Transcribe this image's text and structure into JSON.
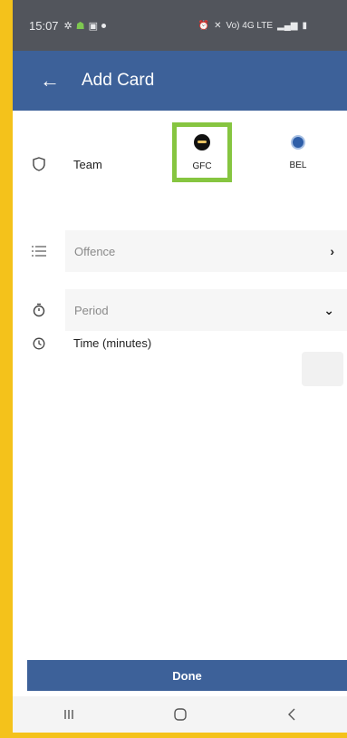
{
  "status_bar": {
    "time": "15:07",
    "right_text": "Vo) 4G LTE"
  },
  "app_bar": {
    "title": "Add Card"
  },
  "team_row": {
    "label": "Team",
    "options": [
      {
        "code": "GFC",
        "selected": true
      },
      {
        "code": "BEL",
        "selected": false
      }
    ]
  },
  "offence_field": {
    "placeholder": "Offence"
  },
  "period_field": {
    "placeholder": "Period"
  },
  "time_row": {
    "label": "Time (minutes)",
    "value": ""
  },
  "done_button": {
    "label": "Done"
  },
  "colors": {
    "primary": "#3d6199",
    "selected_border": "#86c540",
    "frame": "#f4c21b"
  }
}
